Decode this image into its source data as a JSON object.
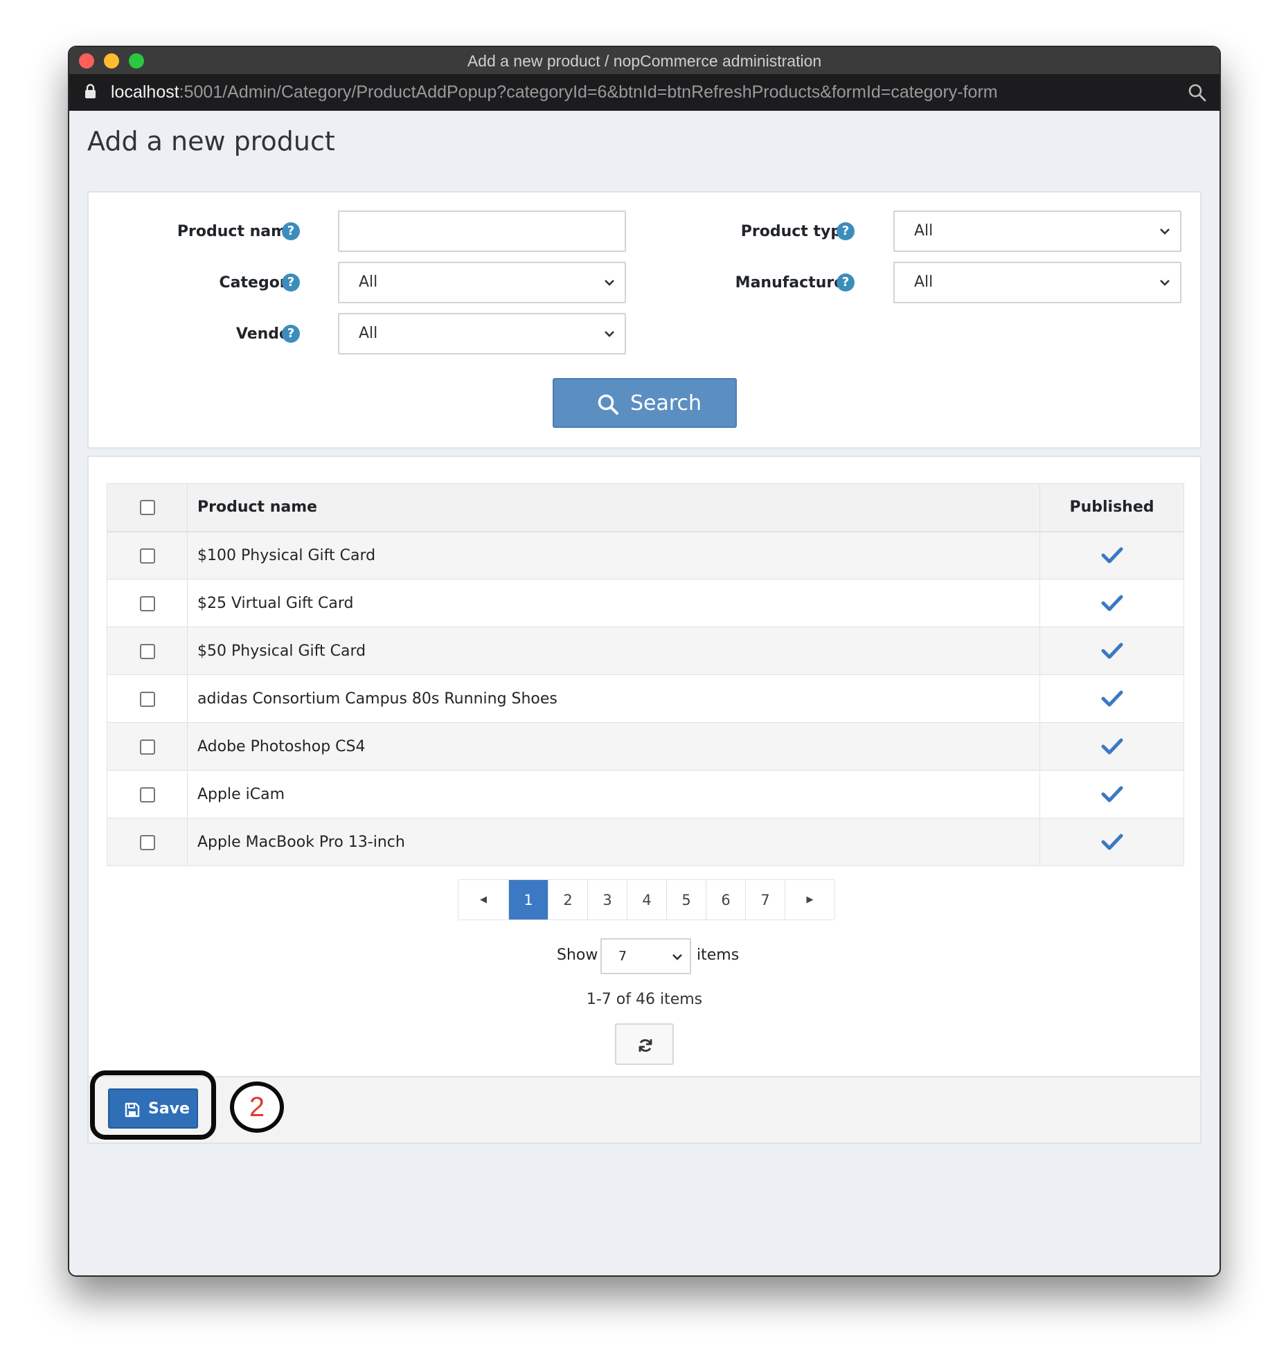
{
  "window": {
    "title": "Add a new product / nopCommerce administration",
    "url_host": "localhost",
    "url_path": ":5001/Admin/Category/ProductAddPopup?categoryId=6&btnId=btnRefreshProducts&formId=category-form"
  },
  "page": {
    "title": "Add a new product"
  },
  "search": {
    "product_name_label": "Product name",
    "product_name_value": "",
    "category_label": "Category",
    "category_value": "All",
    "vendor_label": "Vendor",
    "vendor_value": "All",
    "product_type_label": "Product type",
    "product_type_value": "All",
    "manufacturer_label": "Manufacturer",
    "manufacturer_value": "All",
    "help_glyph": "?",
    "search_button": "Search"
  },
  "grid": {
    "columns": [
      "",
      "Product name",
      "Published"
    ],
    "rows": [
      {
        "name": "$100 Physical Gift Card",
        "published": true
      },
      {
        "name": "$25 Virtual Gift Card",
        "published": true
      },
      {
        "name": "$50 Physical Gift Card",
        "published": true
      },
      {
        "name": "adidas Consortium Campus 80s Running Shoes",
        "published": true
      },
      {
        "name": "Adobe Photoshop CS4",
        "published": true
      },
      {
        "name": "Apple iCam",
        "published": true
      },
      {
        "name": "Apple MacBook Pro 13-inch",
        "published": true
      }
    ]
  },
  "pager": {
    "prev": "◀",
    "pages": [
      "1",
      "2",
      "3",
      "4",
      "5",
      "6",
      "7"
    ],
    "active_page": "1",
    "next": "▶",
    "show_label": "Show",
    "page_size": "7",
    "items_label": "items",
    "range_text": "1-7 of 46 items"
  },
  "footer": {
    "save_label": "Save",
    "step_number": "2"
  },
  "colors": {
    "primary": "#3c78c3",
    "search_button": "#5b8ec1",
    "save_button": "#2e6fb8",
    "help_icon": "#3c8dbc",
    "check_mark": "#3c78c3",
    "step_number": "#e23b2e"
  },
  "icons": {
    "search": "search-icon",
    "save": "floppy-disk-icon",
    "refresh": "refresh-icon",
    "published": "check-icon",
    "help": "question-circle-icon",
    "lock": "lock-icon",
    "zoom": "magnifier-icon"
  }
}
